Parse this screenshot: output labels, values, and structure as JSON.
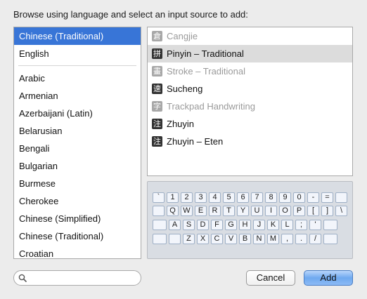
{
  "dialog": {
    "prompt": "Browse using language and select an input source to add:"
  },
  "languages": [
    "Chinese (Traditional)",
    "English",
    "Arabic",
    "Armenian",
    "Azerbaijani (Latin)",
    "Belarusian",
    "Bengali",
    "Bulgarian",
    "Burmese",
    "Cherokee",
    "Chinese (Simplified)",
    "Chinese (Traditional)",
    "Croatian"
  ],
  "sources": [
    {
      "label": "Cangjie",
      "glyph": "倉",
      "disabled": true
    },
    {
      "label": "Pinyin – Traditional",
      "glyph": "拼",
      "disabled": false
    },
    {
      "label": "Stroke – Traditional",
      "glyph": "畫",
      "disabled": true
    },
    {
      "label": "Sucheng",
      "glyph": "速",
      "disabled": false
    },
    {
      "label": "Trackpad Handwriting",
      "glyph": "字",
      "disabled": true
    },
    {
      "label": "Zhuyin",
      "glyph": "注",
      "disabled": false
    },
    {
      "label": "Zhuyin – Eten",
      "glyph": "注",
      "disabled": false
    }
  ],
  "keyboard": {
    "rows": [
      [
        "`",
        "1",
        "2",
        "3",
        "4",
        "5",
        "6",
        "7",
        "8",
        "9",
        "0",
        "-",
        "="
      ],
      [
        "Q",
        "W",
        "E",
        "R",
        "T",
        "Y",
        "U",
        "I",
        "O",
        "P",
        "[",
        "]",
        "\\"
      ],
      [
        "A",
        "S",
        "D",
        "F",
        "G",
        "H",
        "J",
        "K",
        "L",
        ";",
        "'"
      ],
      [
        "Z",
        "X",
        "C",
        "V",
        "B",
        "N",
        "M",
        ",",
        ".",
        "/"
      ]
    ]
  },
  "search": {
    "placeholder": "",
    "value": ""
  },
  "buttons": {
    "cancel": "Cancel",
    "add": "Add"
  },
  "colors": {
    "selection": "#3875d7",
    "highlight": "#dcdcdc",
    "default_button": "#6fa9ef"
  }
}
